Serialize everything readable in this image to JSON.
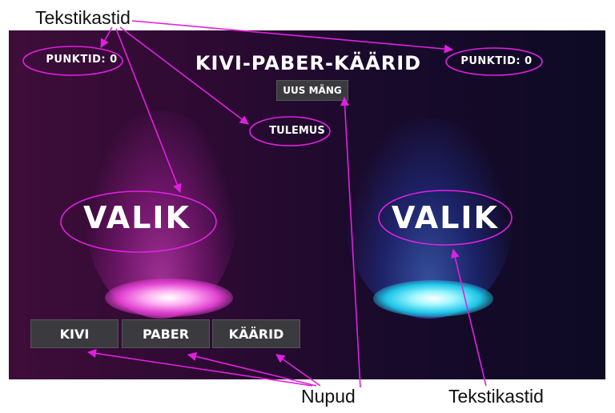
{
  "callouts": {
    "top_label": "Tekstikastid",
    "bottom_buttons_label": "Nupud",
    "bottom_text_label": "Tekstikastid"
  },
  "game": {
    "title": "KIVI-PABER-KÄÄRID",
    "new_game_label": "UUS MÄNG",
    "score_left": "PUNKTID: 0",
    "score_right": "PUNKTID: 0",
    "result": "TULEMUS",
    "choice_left": "VALIK",
    "choice_right": "VALIK",
    "buttons": [
      "KIVI",
      "PABER",
      "KÄÄRID"
    ]
  },
  "colors": {
    "annotation": "#e020e0",
    "left_glow": "#e040d0",
    "right_glow": "#1fc6e8"
  }
}
